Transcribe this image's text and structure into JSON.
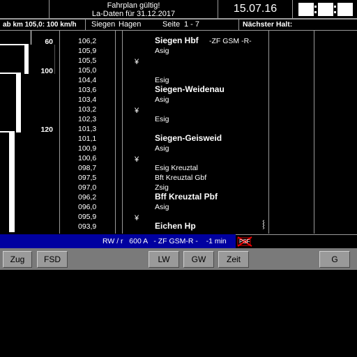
{
  "header": {
    "validity_line1": "Fahrplan gültig!",
    "validity_line2": "La-Daten für 31.12.2017",
    "date": "15.07.16"
  },
  "subheader": {
    "speed_info": "ab km 105,0: 100 km/h",
    "route_from": "Siegen",
    "route_to": "Hagen",
    "page_label": "Seite",
    "page_range": "1 - 7",
    "next_stop_label": "Nächster Halt:"
  },
  "speed_marks": [
    "60",
    "100",
    "120"
  ],
  "rows": [
    {
      "km": "106,2",
      "yen": "",
      "location": "Siegen Hbf",
      "bold": true,
      "note": "-ZF GSM -R-"
    },
    {
      "km": "105,9",
      "yen": "",
      "location": "Asig",
      "bold": false,
      "note": ""
    },
    {
      "km": "105,5",
      "yen": "¥",
      "location": "",
      "bold": false,
      "note": ""
    },
    {
      "km": "105,0",
      "yen": "",
      "location": "",
      "bold": false,
      "note": ""
    },
    {
      "km": "104,4",
      "yen": "",
      "location": "Esig",
      "bold": false,
      "note": ""
    },
    {
      "km": "103,6",
      "yen": "",
      "location": "Siegen-Weidenau",
      "bold": true,
      "note": ""
    },
    {
      "km": "103,4",
      "yen": "",
      "location": "Asig",
      "bold": false,
      "note": ""
    },
    {
      "km": "103,2",
      "yen": "¥",
      "location": "",
      "bold": false,
      "note": ""
    },
    {
      "km": "102,3",
      "yen": "",
      "location": "Esig",
      "bold": false,
      "note": ""
    },
    {
      "km": "101,3",
      "yen": "",
      "location": "",
      "bold": false,
      "note": ""
    },
    {
      "km": "101,1",
      "yen": "",
      "location": "Siegen-Geisweid",
      "bold": true,
      "note": ""
    },
    {
      "km": "100,9",
      "yen": "",
      "location": "Asig",
      "bold": false,
      "note": ""
    },
    {
      "km": "100,6",
      "yen": "¥",
      "location": "",
      "bold": false,
      "note": ""
    },
    {
      "km": "098,7",
      "yen": "",
      "location": "Esig Kreuztal",
      "bold": false,
      "note": ""
    },
    {
      "km": "097,5",
      "yen": "",
      "location": "Bft Kreuztal Gbf",
      "bold": false,
      "note": ""
    },
    {
      "km": "097,0",
      "yen": "",
      "location": "Zsig",
      "bold": false,
      "note": ""
    },
    {
      "km": "096,2",
      "yen": "",
      "location": "Bff Kreuztal Pbf",
      "bold": true,
      "note": ""
    },
    {
      "km": "096,0",
      "yen": "",
      "location": "Asig",
      "bold": false,
      "note": ""
    },
    {
      "km": "095,9",
      "yen": "¥",
      "location": "",
      "bold": false,
      "note": ""
    },
    {
      "km": "093,9",
      "yen": "",
      "location": "Eichen Hp",
      "bold": true,
      "note": ""
    }
  ],
  "status_bar": {
    "text": "RW / r   600 A   - ZF GSM-R -    -1 min",
    "icon_label": "PSF",
    "color": "#0000a0"
  },
  "buttons": {
    "zug": "Zug",
    "fsd": "FSD",
    "lw": "LW",
    "gw": "GW",
    "zeit": "Zeit",
    "g": "G"
  }
}
